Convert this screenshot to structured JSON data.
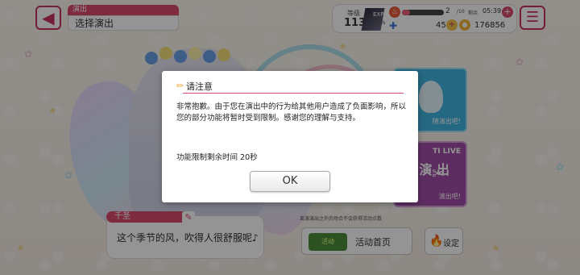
{
  "header": {
    "title_tag": "演出",
    "title": "选择演出",
    "level_label": "等级",
    "level_value": "113",
    "exp_label": "EXP",
    "exp_percent": "55%",
    "stamina_value": "2",
    "stamina_max": "/10",
    "time_label": "剩余",
    "time_value": "05:39",
    "gem_value": "45",
    "coin_value": "176856"
  },
  "panels": {
    "blue_label": "随演出吧!",
    "purple_head": "TI LIVE",
    "purple_big": "演\n出",
    "purple_label": "演出吧!"
  },
  "dialog": {
    "character_name": "千圣",
    "line": "这个季节的风，吹得人很舒服呢♪"
  },
  "bottom": {
    "note": "离演演出之外的场合不会获得活动点数",
    "event_logo": "活动",
    "event_label": "活动首页",
    "settings_label": "设定"
  },
  "modal": {
    "title": "请注意",
    "message": "非常抱歉。由于您在演出中的行为给其他用户造成了负面影响，所以您的部分功能将暂时受到限制。感谢您的理解与支持。",
    "timer": "功能限制剩余时间 20秒",
    "ok_label": "OK"
  },
  "colors": {
    "accent": "#d94a6e",
    "overlay": "rgba(0,0,0,0.42)",
    "panel_blue": "#41b3e0",
    "panel_purple": "#a04ea8"
  },
  "icons": [
    "back-arrow-icon",
    "menu-icon",
    "stamina-icon",
    "plus-icon",
    "gem-icon",
    "coin-icon",
    "pencil-icon",
    "edit-icon",
    "fire-icon"
  ]
}
